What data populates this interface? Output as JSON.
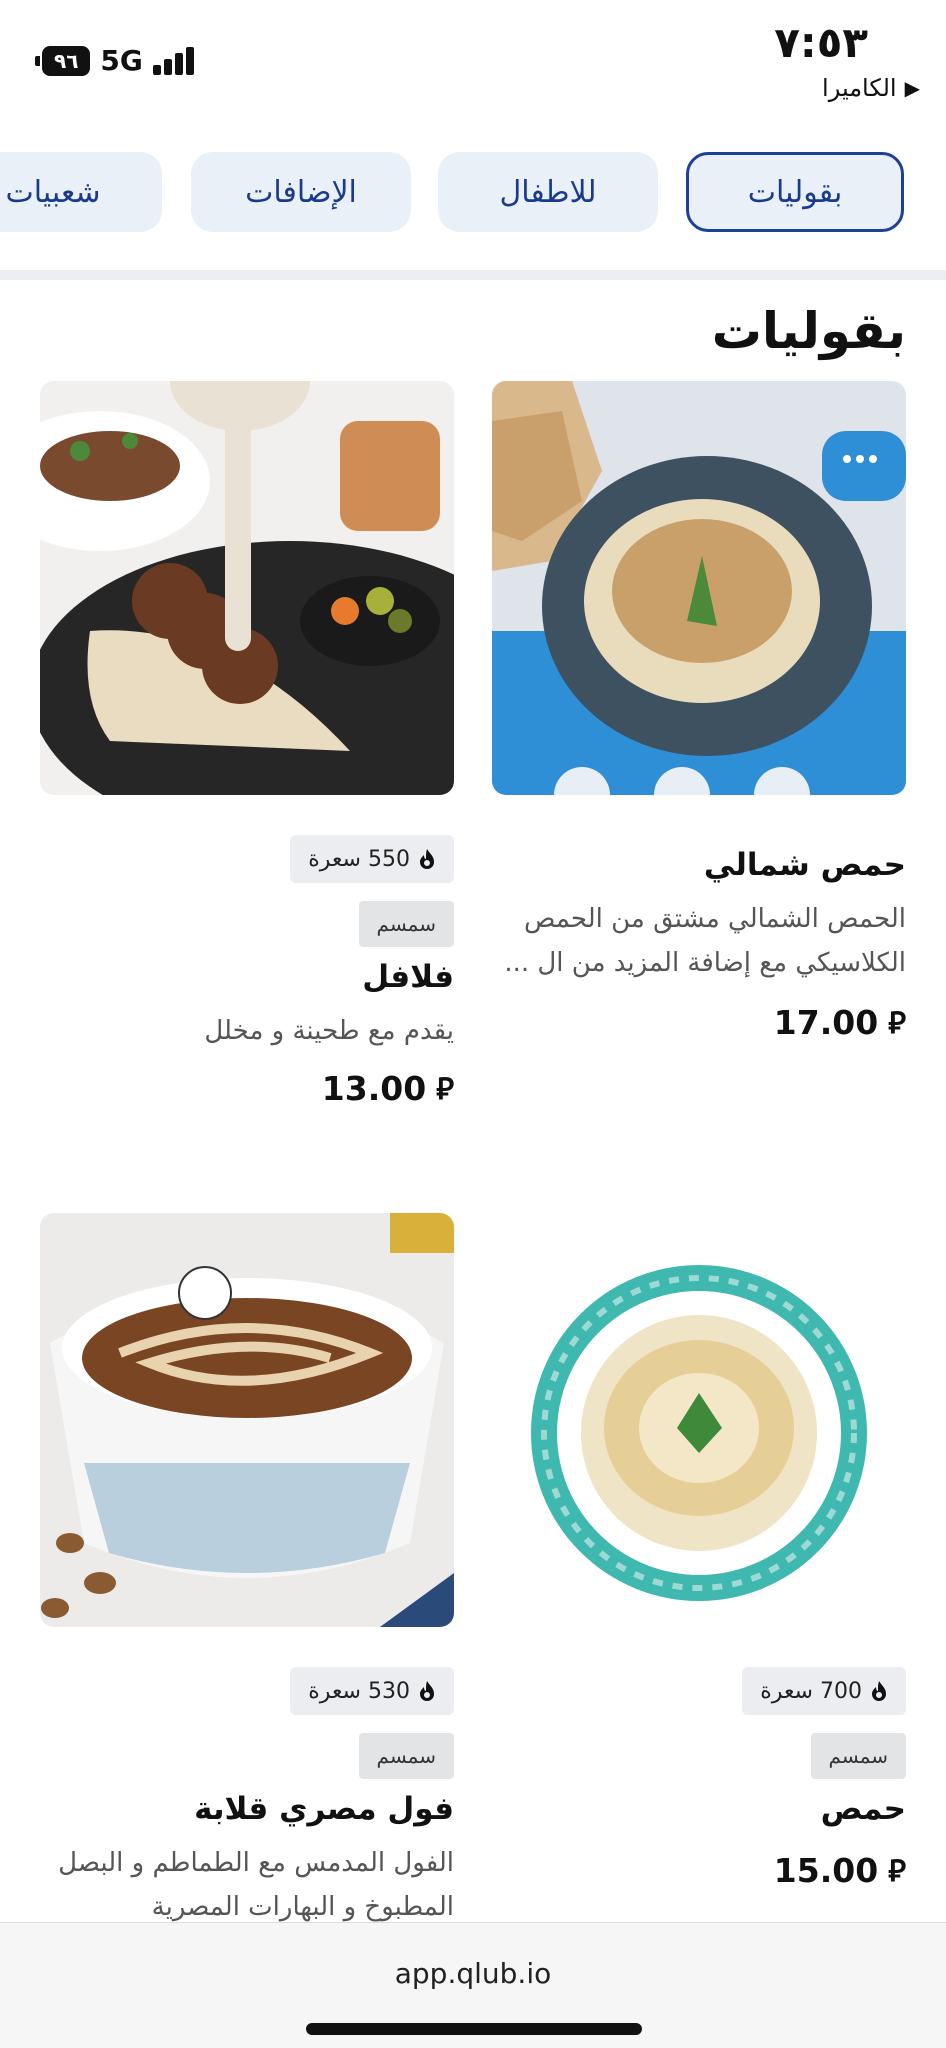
{
  "status_bar": {
    "time": "٧:٥٣",
    "back_label": "الكاميرا",
    "battery": "٩٦",
    "network": "5G"
  },
  "tabs": [
    {
      "label": "بقوليات",
      "active": true
    },
    {
      "label": "للاطفال",
      "active": false
    },
    {
      "label": "الإضافات",
      "active": false
    },
    {
      "label": "شعبيات",
      "active": false
    }
  ],
  "section": {
    "title": "بقوليات"
  },
  "items": [
    {
      "name": "حمص شمالي",
      "description": "الحمص الشمالي مشتق من الحمص الكلاسيكي مع إضافة المزيد من ال ...",
      "price": "17.00",
      "currency_symbol": "⃁",
      "image_icon": "hummus-plate-image"
    },
    {
      "name": "فلافل",
      "description": "يقدم مع طحينة و مخلل",
      "price": "13.00",
      "currency_symbol": "⃁",
      "calories": "550 سعرة",
      "allergen": "سمسم",
      "image_icon": "falafel-plate-image"
    },
    {
      "name": "حمص",
      "price": "15.00",
      "currency_symbol": "⃁",
      "calories": "700 سعرة",
      "allergen": "سمسم",
      "image_icon": "hummus-bowl-image"
    },
    {
      "name": "فول مصري قلابة",
      "description": "الفول المدمس مع الطماطم و البصل المطبوخ و البهارات المصرية",
      "calories": "530 سعرة",
      "allergen": "سمسم",
      "image_icon": "foul-bowl-image"
    }
  ],
  "footer": {
    "url": "app.qlub.io"
  },
  "colors": {
    "accent": "#1e3f9a",
    "tab_bg": "#eaf0f8",
    "chip_bg": "#ecedf0"
  }
}
